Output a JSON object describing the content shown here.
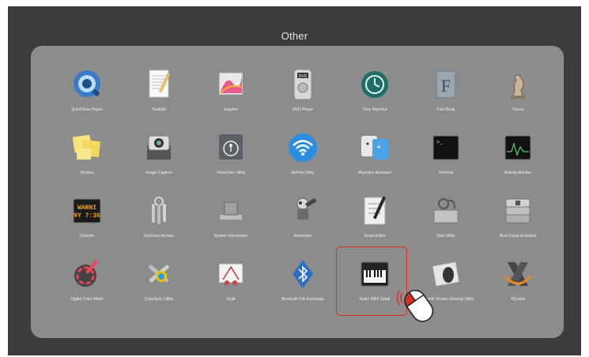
{
  "folder": {
    "title": "Other"
  },
  "apps": [
    {
      "label": "QuickTime Player",
      "icon": "quicktime-icon"
    },
    {
      "label": "TextEdit",
      "icon": "textedit-icon"
    },
    {
      "label": "Grapher",
      "icon": "grapher-icon"
    },
    {
      "label": "DVD Player",
      "icon": "dvd-player-icon"
    },
    {
      "label": "Time Machine",
      "icon": "time-machine-icon"
    },
    {
      "label": "Font Book",
      "icon": "font-book-icon"
    },
    {
      "label": "Chess",
      "icon": "chess-icon"
    },
    {
      "label": "Stickies",
      "icon": "stickies-icon"
    },
    {
      "label": "Image Capture",
      "icon": "image-capture-icon"
    },
    {
      "label": "VoiceOver Utility",
      "icon": "voiceover-icon"
    },
    {
      "label": "AirPort Utility",
      "icon": "airport-icon"
    },
    {
      "label": "Migration Assistant",
      "icon": "migration-icon"
    },
    {
      "label": "Terminal",
      "icon": "terminal-icon"
    },
    {
      "label": "Activity Monitor",
      "icon": "activity-monitor-icon"
    },
    {
      "label": "Console",
      "icon": "console-icon",
      "glyph": "WARNI\n9Y 7:36"
    },
    {
      "label": "Keychain Access",
      "icon": "keychain-icon"
    },
    {
      "label": "System Information",
      "icon": "system-info-icon"
    },
    {
      "label": "Automator",
      "icon": "automator-icon"
    },
    {
      "label": "Script Editor",
      "icon": "script-editor-icon"
    },
    {
      "label": "Disk Utility",
      "icon": "disk-utility-icon"
    },
    {
      "label": "Boot Camp Assistant",
      "icon": "boot-camp-icon"
    },
    {
      "label": "Digital Color Meter",
      "icon": "color-meter-icon"
    },
    {
      "label": "ColorSync Utility",
      "icon": "colorsync-icon"
    },
    {
      "label": "Grab",
      "icon": "grab-icon"
    },
    {
      "label": "Bluetooth File Exchange",
      "icon": "bluetooth-icon"
    },
    {
      "label": "Audio MIDI Setup",
      "icon": "audio-midi-icon",
      "selected": true
    },
    {
      "label": "Bluetooth Screen Sharing Utility",
      "icon": "mouse-icon"
    },
    {
      "label": "XQuartz",
      "icon": "xquartz-icon"
    }
  ],
  "colors": {
    "highlight": "#d8312a",
    "panel": "#8c8c8c",
    "background": "#3c3c3c"
  },
  "cursor": {
    "icon": "mouse-click-icon"
  }
}
